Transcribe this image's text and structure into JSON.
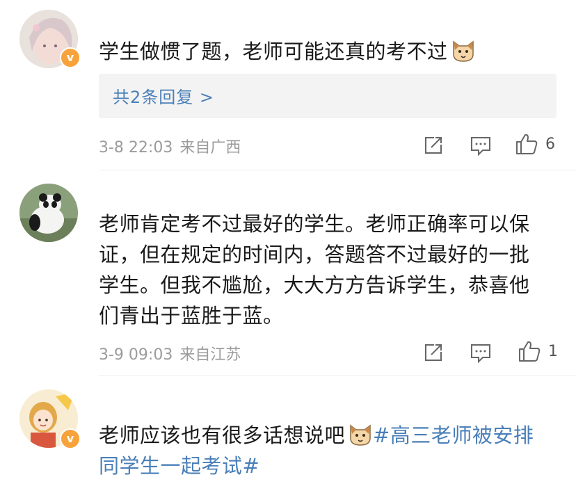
{
  "comments": [
    {
      "text": "学生做惯了题，老师可能还真的考不过",
      "emoji": "cat-emoji",
      "replies": "共2条回复 >",
      "time": "3-8 22:03",
      "location": "来自广西",
      "likes": "6",
      "verified": true
    },
    {
      "text_lines": [
        "老师肯定考不过最好的学生。老师正确率可以保",
        "证，但在规定的时间内，答题答不过最好的一批",
        "学生。但我不尴尬，大大方方告诉学生，恭喜他",
        "们青出于蓝胜于蓝。"
      ],
      "time": "3-9 09:03",
      "location": "来自江苏",
      "likes": "1",
      "verified": false
    },
    {
      "text": "老师应该也有很多话想说吧",
      "emoji": "cat-emoji",
      "hashtag_line1": "#高三老师被安排",
      "hashtag_line2": "同学生一起考试#",
      "verified": true
    }
  ],
  "icons": {
    "share": "share-icon",
    "comment": "comment-icon",
    "like": "thumbs-up-icon"
  },
  "colors": {
    "link": "#4a7fb8",
    "meta": "#9b9b9b",
    "badge": "#f7a23a"
  }
}
